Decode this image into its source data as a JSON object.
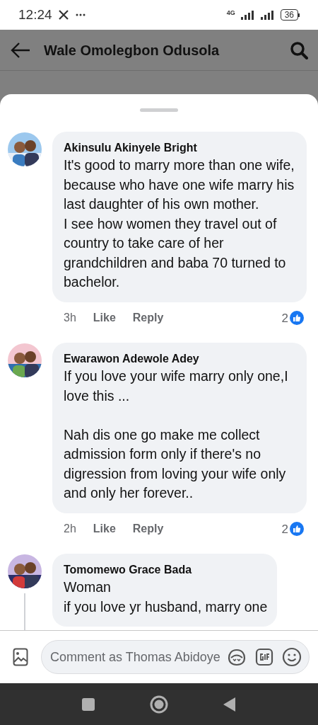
{
  "status_bar": {
    "time": "12:24",
    "network": "4G",
    "battery": "36"
  },
  "header": {
    "title": "Wale Omolegbon Odusola"
  },
  "comments": [
    {
      "author": "Akinsulu Akinyele Bright",
      "text": "It's good to marry more than one wife, because who have one wife marry his last daughter of his own mother.\nI see how women they travel out of country to take care of her grandchildren and baba 70 turned to bachelor.",
      "time": "3h",
      "like": "Like",
      "reply": "Reply",
      "reactions": "2",
      "thread": false
    },
    {
      "author": "Ewarawon Adewole Adey",
      "text": "If you love your wife marry only one,I love this ...\n\nNah dis one go make me collect admission form only if there's no digression from loving your wife only and only her forever..",
      "time": "2h",
      "like": "Like",
      "reply": "Reply",
      "reactions": "2",
      "thread": false
    },
    {
      "author": "Tomomewo Grace Bada",
      "text": "Woman\n if you love yr husband, marry one",
      "thread": true
    }
  ],
  "composer": {
    "placeholder": "Comment as Thomas Abidoye"
  }
}
